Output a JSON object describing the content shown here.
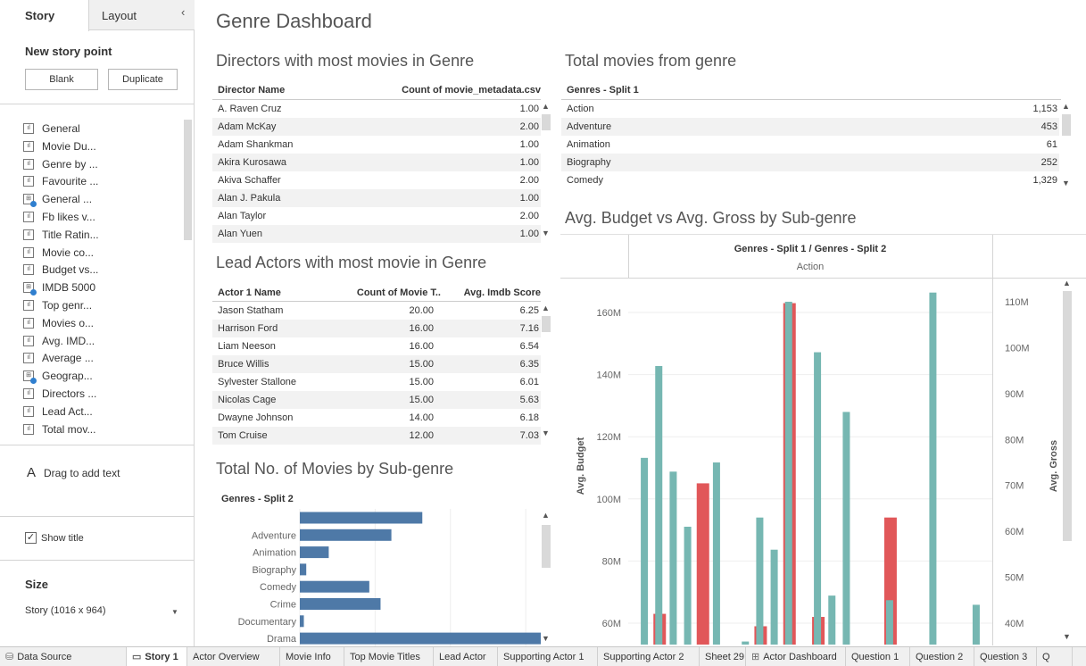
{
  "sidebar": {
    "tab_story": "Story",
    "tab_layout": "Layout",
    "collapse_icon": "chevron-left-icon",
    "new_story_point": "New story point",
    "blank_button": "Blank",
    "duplicate_button": "Duplicate",
    "story_points": [
      {
        "label": "General",
        "icon": "sheet"
      },
      {
        "label": "Movie Du...",
        "icon": "sheet"
      },
      {
        "label": "Genre by ...",
        "icon": "sheet"
      },
      {
        "label": "Favourite ...",
        "icon": "sheet"
      },
      {
        "label": "General ...",
        "icon": "dashboard"
      },
      {
        "label": "Fb likes v...",
        "icon": "sheet"
      },
      {
        "label": "Title Ratin...",
        "icon": "sheet"
      },
      {
        "label": "Movie co...",
        "icon": "sheet"
      },
      {
        "label": "Budget vs...",
        "icon": "sheet"
      },
      {
        "label": "IMDB 5000",
        "icon": "dashboard"
      },
      {
        "label": "Top genr...",
        "icon": "sheet"
      },
      {
        "label": "Movies o...",
        "icon": "sheet"
      },
      {
        "label": "Avg. IMD...",
        "icon": "sheet"
      },
      {
        "label": "Average ...",
        "icon": "sheet"
      },
      {
        "label": "Geograp...",
        "icon": "dashboard"
      },
      {
        "label": "Directors ...",
        "icon": "sheet"
      },
      {
        "label": "Lead Act...",
        "icon": "sheet"
      },
      {
        "label": "Total mov...",
        "icon": "sheet"
      }
    ],
    "drag_icon": "A",
    "drag_text": "Drag to add text",
    "show_title": "Show title",
    "size_heading": "Size",
    "size_value": "Story (1016 x 964)"
  },
  "dashboard": {
    "title": "Genre Dashboard",
    "directors": {
      "title": "Directors with most movies in Genre",
      "col1": "Director Name",
      "col2": "Count of movie_metadata.csv",
      "rows": [
        [
          "A. Raven Cruz",
          "1.00"
        ],
        [
          "Adam McKay",
          "2.00"
        ],
        [
          "Adam Shankman",
          "1.00"
        ],
        [
          "Akira Kurosawa",
          "1.00"
        ],
        [
          "Akiva Schaffer",
          "2.00"
        ],
        [
          "Alan J. Pakula",
          "1.00"
        ],
        [
          "Alan Taylor",
          "2.00"
        ],
        [
          "Alan Yuen",
          "1.00"
        ]
      ]
    },
    "total_movies": {
      "title": "Total movies from genre",
      "col1": "Genres - Split 1",
      "rows": [
        [
          "Action",
          "1,153"
        ],
        [
          "Adventure",
          "453"
        ],
        [
          "Animation",
          "61"
        ],
        [
          "Biography",
          "252"
        ],
        [
          "Comedy",
          "1,329"
        ]
      ]
    },
    "lead_actors": {
      "title": "Lead Actors with most movie in Genre",
      "col1": "Actor 1 Name",
      "col2": "Count of Movie T..",
      "col3": "Avg. Imdb Score",
      "rows": [
        [
          "Jason Statham",
          "20.00",
          "6.25"
        ],
        [
          "Harrison Ford",
          "16.00",
          "7.16"
        ],
        [
          "Liam Neeson",
          "16.00",
          "6.54"
        ],
        [
          "Bruce Willis",
          "15.00",
          "6.35"
        ],
        [
          "Sylvester Stallone",
          "15.00",
          "6.01"
        ],
        [
          "Nicolas Cage",
          "15.00",
          "5.63"
        ],
        [
          "Dwayne Johnson",
          "14.00",
          "6.18"
        ],
        [
          "Tom Cruise",
          "12.00",
          "7.03"
        ]
      ]
    },
    "subgenre_count": {
      "title": "Total No. of Movies by Sub-genre",
      "header": "Genres - Split 2"
    },
    "budget_gross": {
      "title": "Avg. Budget vs Avg. Gross by Sub-genre",
      "header": "Genres - Split 1 / Genres - Split 2",
      "subheader": "Action"
    }
  },
  "chart_data": [
    {
      "type": "bar",
      "orientation": "horizontal",
      "header": "Genres - Split 2",
      "categories": [
        "",
        "Adventure",
        "Animation",
        "Biography",
        "Comedy",
        "Crime",
        "Documentary",
        "Drama"
      ],
      "values": [
        305,
        228,
        72,
        16,
        173,
        201,
        10,
        600
      ],
      "color": "#4e79a7",
      "grid": "vertical lines"
    },
    {
      "type": "bar",
      "header": "Genres - Split 1 / Genres - Split 2",
      "subheader": "Action",
      "ylabel_left": "Avg. Budget",
      "ylabel_right": "Avg. Gross",
      "left_ticks": [
        "60M",
        "80M",
        "100M",
        "120M",
        "140M",
        "160M"
      ],
      "right_ticks": [
        "40M",
        "50M",
        "60M",
        "70M",
        "80M",
        "90M",
        "100M",
        "110M"
      ],
      "ylim_left": [
        54000000,
        172000000
      ],
      "ylim_right": [
        34000000,
        114000000
      ],
      "series": [
        {
          "name": "Avg. Gross",
          "color": "#76b7b2",
          "values": [
            76,
            96,
            73,
            61,
            0,
            75,
            0,
            36,
            63,
            56,
            110,
            0,
            99,
            46,
            86,
            0,
            0,
            45,
            0,
            0,
            112,
            0,
            0,
            44
          ]
        },
        {
          "name": "Avg. Budget",
          "color": "#e15759",
          "values": [
            0,
            63,
            0,
            0,
            105,
            0,
            0,
            0,
            59,
            0,
            163,
            0,
            62,
            0,
            0,
            0,
            0,
            94,
            0,
            0,
            0,
            0,
            0,
            0
          ]
        }
      ]
    }
  ],
  "bottom_tabs": [
    {
      "label": "Data Source",
      "icon": "database-icon"
    },
    {
      "label": "Story 1",
      "icon": "story-icon",
      "active": true
    },
    {
      "label": "Actor Overview"
    },
    {
      "label": "Movie Info"
    },
    {
      "label": "Top Movie Titles"
    },
    {
      "label": "Lead Actor"
    },
    {
      "label": "Supporting Actor 1"
    },
    {
      "label": "Supporting Actor 2"
    },
    {
      "label": "Sheet 29"
    },
    {
      "label": "Actor Dashboard",
      "icon": "dashboard-icon"
    },
    {
      "label": "Question 1"
    },
    {
      "label": "Question 2"
    },
    {
      "label": "Question 3"
    },
    {
      "label": "Q"
    }
  ],
  "colors": {
    "bar_blue": "#4e79a7",
    "teal": "#76b7b2",
    "red": "#e15759"
  }
}
